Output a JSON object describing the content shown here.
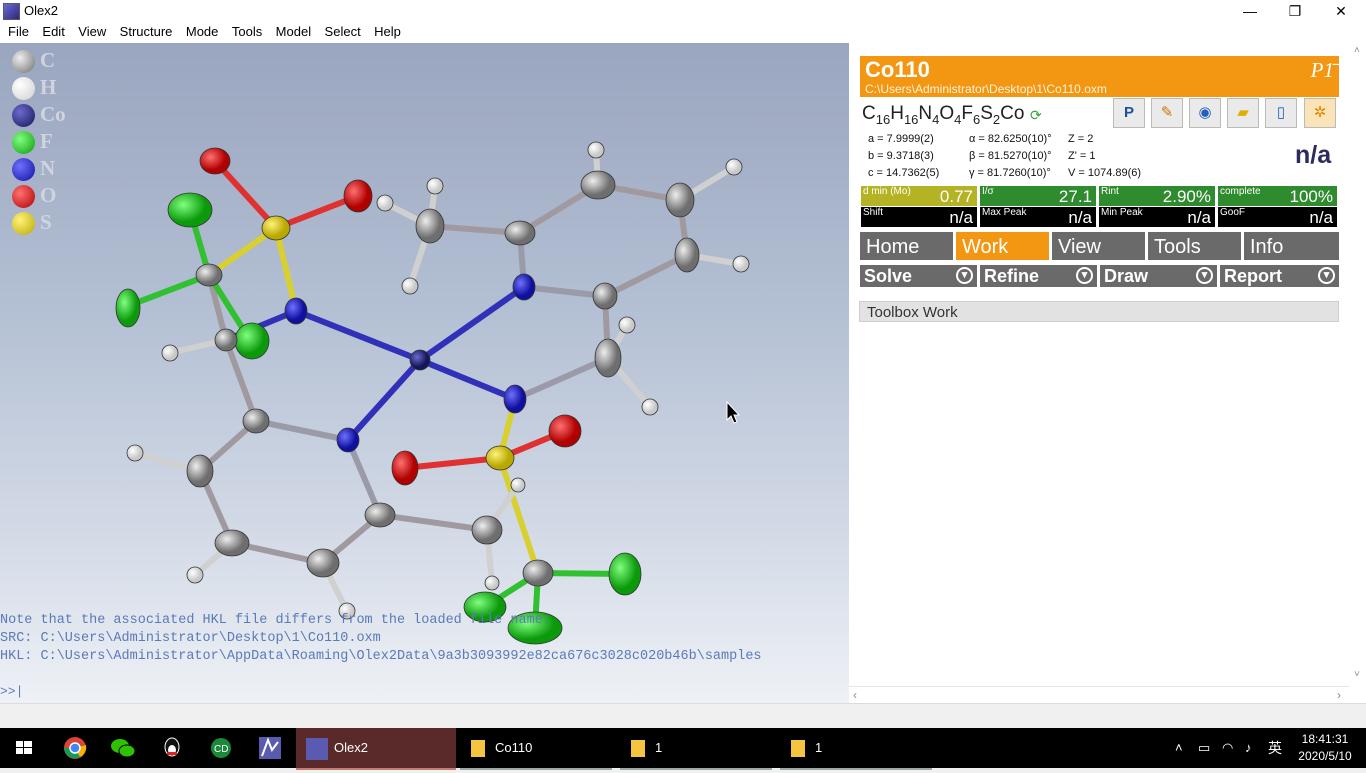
{
  "window": {
    "title": "Olex2",
    "minimize": "—",
    "restore": "❐",
    "close": "✕"
  },
  "menu": [
    "File",
    "Edit",
    "View",
    "Structure",
    "Mode",
    "Tools",
    "Model",
    "Select",
    "Help"
  ],
  "legend": [
    {
      "symbol": "C",
      "color": "#8a8a8a"
    },
    {
      "symbol": "H",
      "color": "#f4f4f4"
    },
    {
      "symbol": "Co",
      "color": "#23238a"
    },
    {
      "symbol": "F",
      "color": "#1fbf1f"
    },
    {
      "symbol": "N",
      "color": "#2020e0"
    },
    {
      "symbol": "O",
      "color": "#e01010"
    },
    {
      "symbol": "S",
      "color": "#e0d020"
    }
  ],
  "console": {
    "lines": [
      "Note that the associated HKL file differs from the loaded file name:",
      "SRC: C:\\Users\\Administrator\\Desktop\\1\\Co110.oxm",
      "HKL: C:\\Users\\Administrator\\AppData\\Roaming\\Olex2Data\\9a3b3093992e82ca676c3028c020b46b\\samples"
    ],
    "prompt": ">>|"
  },
  "structure": {
    "name": "Co110",
    "path": "C:\\Users\\Administrator\\Desktop\\1\\Co110.oxm",
    "space_group": "P1̄",
    "formula_parts": [
      [
        "C",
        "16"
      ],
      [
        "H",
        "16"
      ],
      [
        "N",
        "4"
      ],
      [
        "O",
        "4"
      ],
      [
        "F",
        "6"
      ],
      [
        "S",
        "2"
      ],
      [
        "Co",
        ""
      ]
    ],
    "tools_icons": [
      "platon-icon",
      "pencil-icon",
      "globe-icon",
      "folder-icon",
      "notepad-icon",
      "settings-icon"
    ],
    "cell": [
      [
        "a = 7.9999(2)",
        "α = 82.6250(10)°",
        "Z = 2"
      ],
      [
        "b = 9.3718(3)",
        "β = 81.5270(10)°",
        "Z' = 1"
      ],
      [
        "c = 14.7362(5)",
        "γ = 81.7260(10)°",
        "V = 1074.89(6)"
      ]
    ],
    "na": "n/a",
    "stats_row1": [
      {
        "key": "d min (Mo)",
        "val": "0.77",
        "color": "#b3b323"
      },
      {
        "key": "I/σ",
        "val": "27.1",
        "color": "#2e8b2e"
      },
      {
        "key": "Rint",
        "val": "2.90%",
        "color": "#2e8b2e"
      },
      {
        "key": "complete",
        "val": "100%",
        "color": "#2e8b2e"
      }
    ],
    "stats_row2": [
      {
        "key": "Shift",
        "val": "n/a"
      },
      {
        "key": "Max Peak",
        "val": "n/a"
      },
      {
        "key": "Min Peak",
        "val": "n/a"
      },
      {
        "key": "GooF",
        "val": "n/a"
      }
    ]
  },
  "tabs": [
    "Home",
    "Work",
    "View",
    "Tools",
    "Info"
  ],
  "active_tab": "Work",
  "subtabs": [
    "Solve",
    "Refine",
    "Draw",
    "Report"
  ],
  "toolbox_title": "Toolbox Work",
  "taskbar": {
    "apps": [
      "Olex2",
      "Co110",
      "1",
      "1"
    ],
    "time": "18:41:31",
    "date": "2020/5/10",
    "ime": "英"
  }
}
